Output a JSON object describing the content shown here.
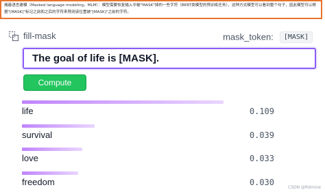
{
  "note": {
    "text": "掩蔽语言建模（Masked language modeling，MLM）：模型需要恢复输入中被\"MASK\"掉的一些字符（BERT类模型的预训练任务），这种方式模型可以看到整个句子，因此模型可以根据\"[MASK]\"标记之前和之后的字符来预测该位置被\"[MASK]\"之前的字符。"
  },
  "header": {
    "task_label": "fill-mask",
    "mask_token_label": "mask_token:",
    "mask_token_value": "[MASK]"
  },
  "input": {
    "value": "The goal of life is [MASK]."
  },
  "compute": {
    "label": "Compute"
  },
  "results": [
    {
      "label": "life",
      "score": "0.109",
      "fill": 1.0
    },
    {
      "label": "survival",
      "score": "0.039",
      "fill": 0.36
    },
    {
      "label": "love",
      "score": "0.033",
      "fill": 0.3
    },
    {
      "label": "freedom",
      "score": "0.030",
      "fill": 0.28
    }
  ],
  "watermark": "CSDN @Rdmine",
  "colors": {
    "accent": "#8b5cf6",
    "button": "#22c55e",
    "bar": "#c084fc",
    "note_border": "#e8722c"
  }
}
